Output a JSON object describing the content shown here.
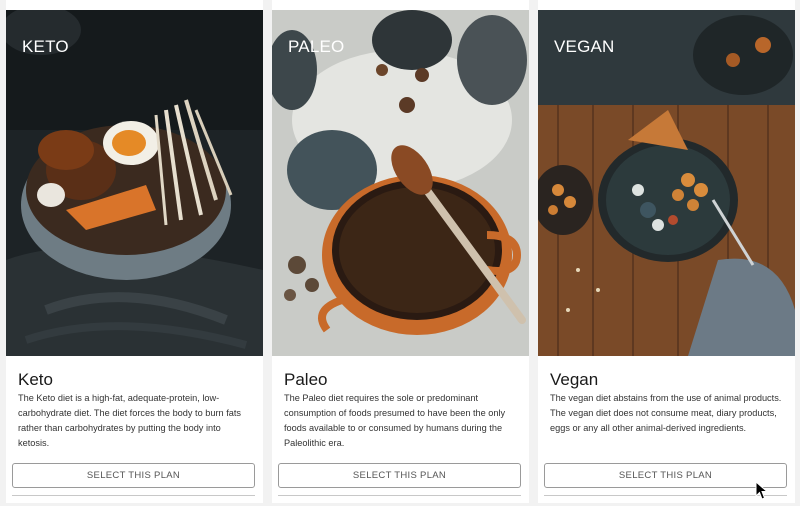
{
  "plans": [
    {
      "photo_label": "KETO",
      "title": "Keto",
      "description": "The Keto diet is a high-fat, adequate-protein, low-carbohydrate diet. The diet forces the body to burn fats rather than carbohydrates by putting the body into ketosis.",
      "button_label": "SELECT THIS PLAN"
    },
    {
      "photo_label": "PALEO",
      "title": "Paleo",
      "description": "The Paleo diet requires the sole or predominant consumption of foods presumed to have been the only foods available to or consumed by humans during the Paleolithic era.",
      "button_label": "SELECT THIS PLAN"
    },
    {
      "photo_label": "VEGAN",
      "title": "Vegan",
      "description": "The vegan diet abstains from the use of animal products. The vegan diet does not consume meat, diary products, eggs or any all other animal-derived ingredients.",
      "button_label": "SELECT THIS PLAN"
    }
  ],
  "colors": {
    "button_border": "#9a9a9a",
    "button_text": "#555555",
    "page_background": "#f2f2f2"
  }
}
